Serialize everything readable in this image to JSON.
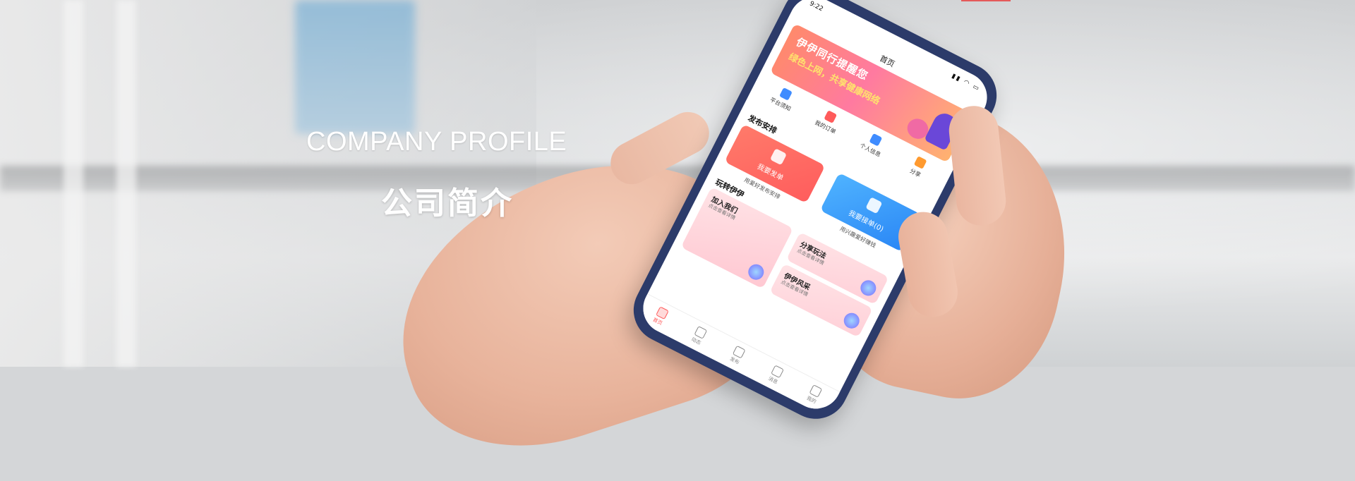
{
  "hero": {
    "eyebrow": "COMPANY PROFILE",
    "title": "公司简介"
  },
  "phone": {
    "status_time": "9:22",
    "nav_title": "首页",
    "banner": {
      "line1": "伊伊同行提醒您",
      "line2": "绿色上网，共享健康网络"
    },
    "quick_actions": [
      {
        "label": "平台须知",
        "icon": "home-icon"
      },
      {
        "label": "我的订单",
        "icon": "order-icon"
      },
      {
        "label": "个人信息",
        "icon": "user-card-icon"
      },
      {
        "label": "分享",
        "icon": "gift-icon"
      }
    ],
    "section_publish": "发布安排",
    "publish_cards": [
      {
        "label": "我要发单",
        "sub": "用爱好发布安排",
        "icon": "send-icon"
      },
      {
        "label": "我要接单(0)",
        "sub": "用兴趣爱好赚钱",
        "icon": "document-icon"
      }
    ],
    "section_play": "玩转伊伊",
    "play_cards": [
      {
        "title": "加入我们",
        "sub": "点击查看详情"
      },
      {
        "title": "分享玩法",
        "sub": "点击查看详情"
      },
      {
        "title": "伊伊风采",
        "sub": "点击查看详情"
      }
    ],
    "tabs": [
      {
        "label": "首页",
        "active": true
      },
      {
        "label": "动态",
        "active": false
      },
      {
        "label": "发布",
        "active": false
      },
      {
        "label": "消息",
        "active": false
      },
      {
        "label": "我的",
        "active": false
      }
    ]
  },
  "colors": {
    "accent": "#ff5b5b",
    "blue": "#2a86f5",
    "phone_frame": "#2c3b6a"
  }
}
